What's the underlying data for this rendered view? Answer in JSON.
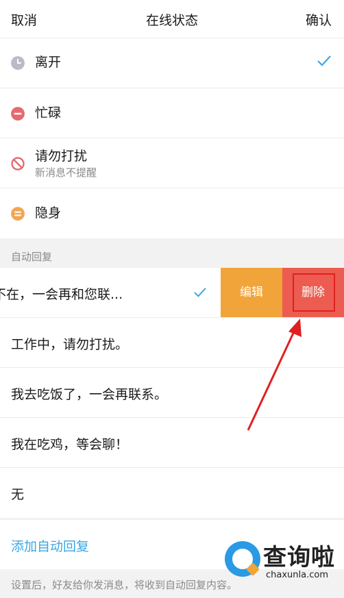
{
  "header": {
    "cancel": "取消",
    "title": "在线状态",
    "confirm": "确认"
  },
  "statuses": [
    {
      "label": "离开",
      "selected": true,
      "icon": "clock-icon",
      "color": "#b9bcc6"
    },
    {
      "label": "忙碌",
      "selected": false,
      "icon": "minus-circle-icon",
      "color": "#e56a70"
    },
    {
      "label": "请勿打扰",
      "sub": "新消息不提醒",
      "selected": false,
      "icon": "no-entry-icon",
      "color": "#e56a70"
    },
    {
      "label": "隐身",
      "selected": false,
      "icon": "equal-circle-icon",
      "color": "#f2a650"
    }
  ],
  "auto_reply": {
    "section_label": "自动回复",
    "items": [
      {
        "text": "不在，一会再和您联...",
        "selected": true
      },
      {
        "text": "工作中，请勿打扰。",
        "selected": false
      },
      {
        "text": "我去吃饭了，一会再联系。",
        "selected": false
      },
      {
        "text": "我在吃鸡，等会聊！",
        "selected": false
      },
      {
        "text": "无",
        "selected": false
      }
    ],
    "swipe_actions": {
      "edit": "编辑",
      "delete": "删除"
    },
    "add_label": "添加自动回复",
    "footer_hint": "设置后，好友给你发消息，将收到自动回复内容。"
  },
  "watermark": {
    "title": "查询啦",
    "url": "chaxunla.com"
  },
  "colors": {
    "accent": "#3aa7e6",
    "edit": "#f0a43a",
    "delete": "#ec5c50",
    "annotation": "#e02020"
  }
}
